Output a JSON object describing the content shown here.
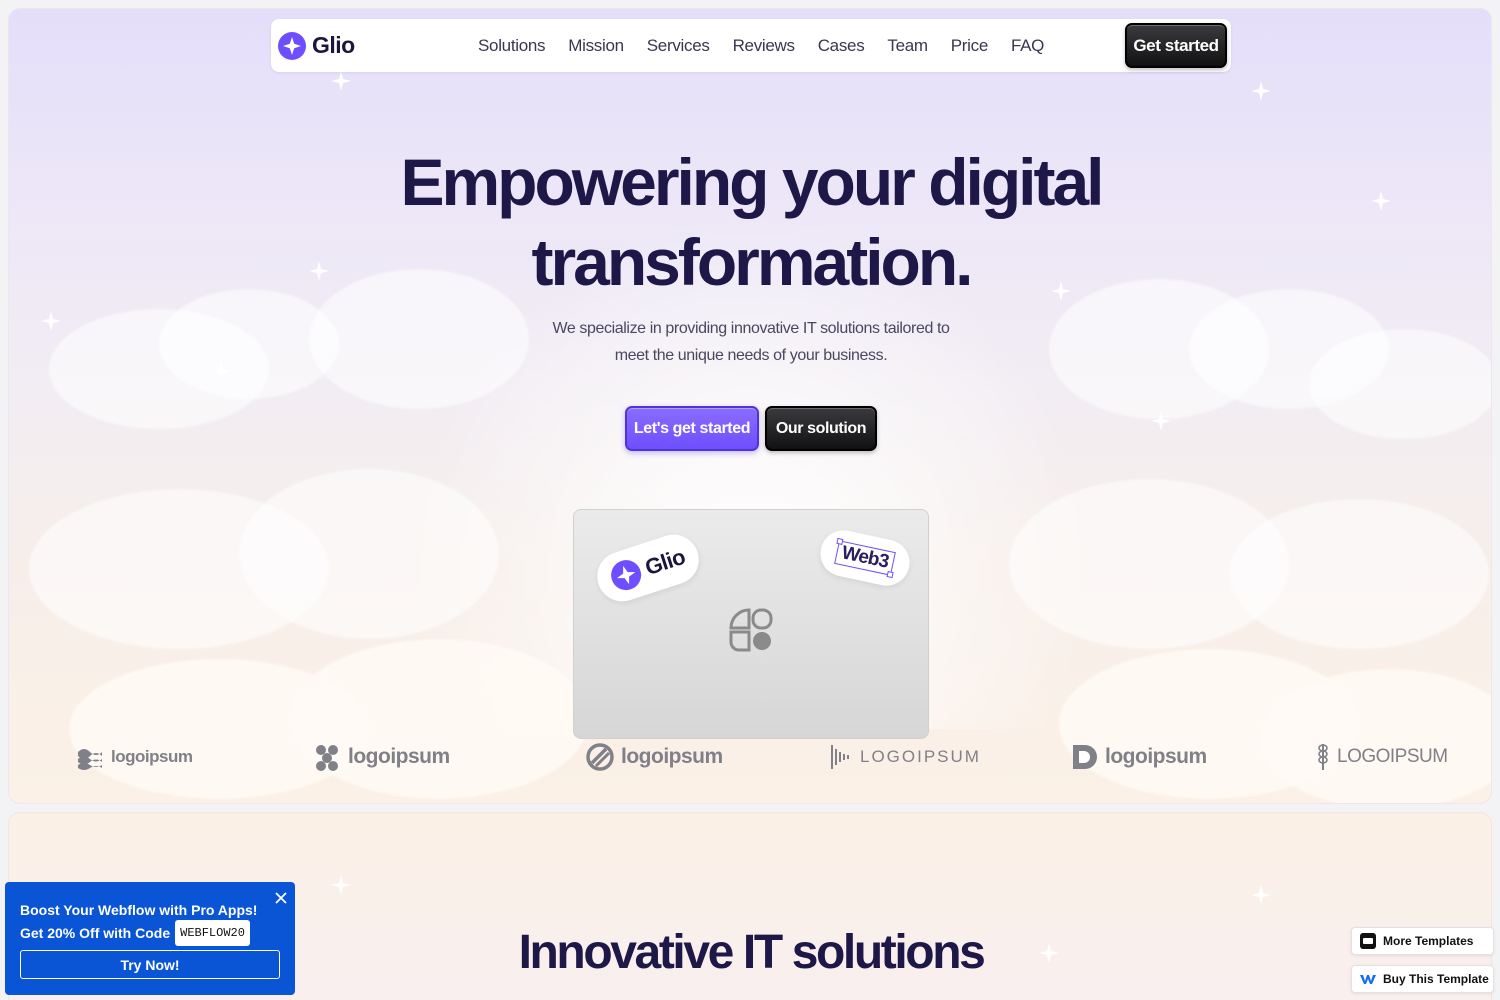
{
  "brand": {
    "name": "Glio",
    "accent": "#6d4fff",
    "dark": "#1e1848"
  },
  "nav": {
    "items": [
      "Solutions",
      "Mission",
      "Services",
      "Reviews",
      "Cases",
      "Team",
      "Price",
      "FAQ"
    ],
    "cta_label": "Get started"
  },
  "hero": {
    "headline_line1": "Empowering your digital",
    "headline_line2": "transformation.",
    "subline_line1": "We specialize in providing innovative IT solutions tailored to",
    "subline_line2": "meet the unique needs of your business.",
    "primary_button": "Let's get started",
    "secondary_button": "Our solution",
    "badge_glio": "Glio",
    "badge_web3": "Web3"
  },
  "logos": [
    "logoipsum",
    "logoipsum",
    "logoipsum",
    "LOGOIPSUM",
    "logoipsum",
    "LOGOIPSUM"
  ],
  "section2": {
    "title_line1": "Innovative IT solutions"
  },
  "promo": {
    "line1": "Boost Your Webflow with Pro Apps!",
    "line2": "Get 20% Off with Code",
    "code": "WEBFLOW20",
    "button": "Try Now!"
  },
  "side_buttons": {
    "more_templates": "More Templates",
    "buy_template": "Buy This Template"
  },
  "icons": [
    "brand-star-icon",
    "close-icon",
    "template-grid-icon",
    "webflow-icon",
    "sparkle-icon"
  ]
}
